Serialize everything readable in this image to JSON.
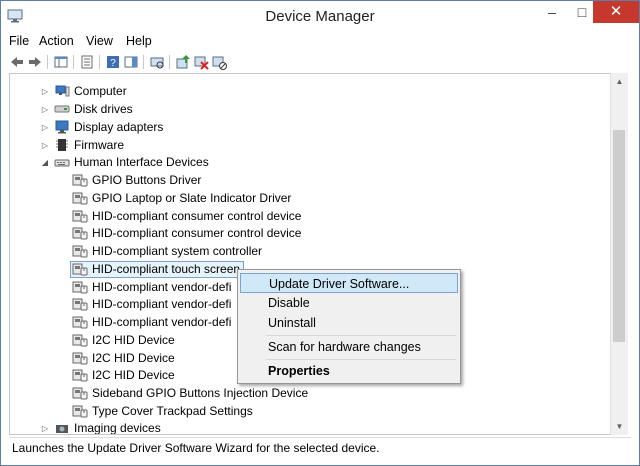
{
  "window": {
    "title": "Device Manager",
    "minimize": "–",
    "maximize": "□",
    "close": "✕"
  },
  "menubar": {
    "items": [
      "File",
      "Action",
      "View",
      "Help"
    ]
  },
  "toolbar": {
    "buttons": [
      "back-icon",
      "forward-icon",
      "show-hide-console-tree-icon",
      "properties-icon",
      "help-icon",
      "show-hide-action-pane-icon",
      "update-driver-icon",
      "uninstall-device-icon",
      "scan-hardware-icon"
    ]
  },
  "tree": {
    "categories": [
      {
        "label": "Computer",
        "expanded": false,
        "icon": "computer-icon"
      },
      {
        "label": "Disk drives",
        "expanded": false,
        "icon": "disk-drive-icon"
      },
      {
        "label": "Display adapters",
        "expanded": false,
        "icon": "display-adapter-icon"
      },
      {
        "label": "Firmware",
        "expanded": false,
        "icon": "firmware-icon"
      },
      {
        "label": "Human Interface Devices",
        "expanded": true,
        "icon": "hid-icon"
      }
    ],
    "hid_children": [
      "GPIO Buttons Driver",
      "GPIO Laptop or Slate Indicator Driver",
      "HID-compliant consumer control device",
      "HID-compliant consumer control device",
      "HID-compliant system controller",
      "HID-compliant touch screen",
      "HID-compliant vendor-defi",
      "HID-compliant vendor-defi",
      "HID-compliant vendor-defi",
      "I2C HID Device",
      "I2C HID Device",
      "I2C HID Device",
      "Sideband GPIO Buttons Injection Device",
      "Type Cover Trackpad Settings"
    ],
    "selected_index": 5,
    "after": {
      "label": "Imaging devices",
      "expanded": false
    }
  },
  "context_menu": {
    "update": "Update Driver Software...",
    "disable": "Disable",
    "uninstall": "Uninstall",
    "scan": "Scan for hardware changes",
    "properties": "Properties"
  },
  "statusbar": {
    "text": "Launches the Update Driver Software Wizard for the selected device."
  }
}
